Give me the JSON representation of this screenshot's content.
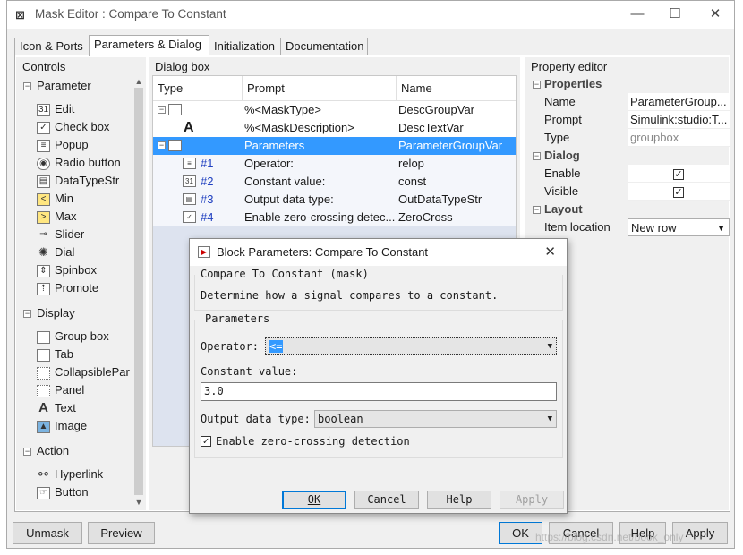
{
  "window": {
    "title": "Mask Editor : Compare To Constant",
    "icon": "mask-editor-icon",
    "minimize": "—",
    "maximize": "☐",
    "close": "✕"
  },
  "tabs": [
    {
      "label": "Icon & Ports"
    },
    {
      "label": "Parameters & Dialog"
    },
    {
      "label": "Initialization"
    },
    {
      "label": "Documentation"
    }
  ],
  "controls": {
    "heading": "Controls",
    "groups": {
      "parameter": {
        "label": "Parameter",
        "items": [
          "Edit",
          "Check box",
          "Popup",
          "Radio button",
          "DataTypeStr",
          "Min",
          "Max",
          "Slider",
          "Dial",
          "Spinbox",
          "Promote"
        ]
      },
      "display": {
        "label": "Display",
        "items": [
          "Group box",
          "Tab",
          "CollapsiblePar",
          "Panel",
          "Text",
          "Image"
        ]
      },
      "action": {
        "label": "Action",
        "items": [
          "Hyperlink",
          "Button"
        ]
      }
    }
  },
  "dialog_box": {
    "heading": "Dialog box",
    "columns": [
      "Type",
      "Prompt",
      "Name"
    ],
    "rows": [
      {
        "num": "",
        "prompt": "%<MaskType>",
        "name": "DescGroupVar"
      },
      {
        "num": "",
        "prompt": "%<MaskDescription>",
        "name": "DescTextVar"
      },
      {
        "num": "",
        "prompt": "Parameters",
        "name": "ParameterGroupVar"
      },
      {
        "num": "#1",
        "prompt": "Operator:",
        "name": "relop"
      },
      {
        "num": "#2",
        "prompt": "Constant value:",
        "name": "const"
      },
      {
        "num": "#3",
        "prompt": "Output data type:",
        "name": "OutDataTypeStr"
      },
      {
        "num": "#4",
        "prompt": "Enable zero-crossing detec...",
        "name": "ZeroCross"
      }
    ],
    "text_glyph": "A"
  },
  "property_editor": {
    "heading": "Property editor",
    "properties": {
      "label": "Properties",
      "name_key": "Name",
      "name_val": "ParameterGroup...",
      "prompt_key": "Prompt",
      "prompt_val": "Simulink:studio:T...",
      "type_key": "Type",
      "type_val": "groupbox"
    },
    "dialog": {
      "label": "Dialog",
      "enable_key": "Enable",
      "enable_val": "✓",
      "visible_key": "Visible",
      "visible_val": "✓"
    },
    "layout": {
      "label": "Layout",
      "item_location_key": "Item location",
      "item_location_val": "New row"
    }
  },
  "bottom_buttons": {
    "unmask": "Unmask",
    "preview": "Preview",
    "ok": "OK",
    "cancel": "Cancel",
    "help": "Help",
    "apply": "Apply"
  },
  "block_dialog": {
    "title": "Block Parameters: Compare To Constant",
    "close": "✕",
    "mask_legend": "Compare To Constant (mask)",
    "description": "Determine how a signal compares to a constant.",
    "params_legend": "Parameters",
    "operator_label": "Operator:",
    "operator_value": "<=",
    "constant_label": "Constant value:",
    "constant_value": "3.0",
    "output_label": "Output data type:",
    "output_value": "boolean",
    "zero_crossing_label": "Enable zero-crossing detection",
    "zero_crossing_checked": "✓",
    "ok": "OK",
    "cancel": "Cancel",
    "help": "Help",
    "apply": "Apply"
  },
  "watermark": "https://blog.csdn.net/book_only"
}
